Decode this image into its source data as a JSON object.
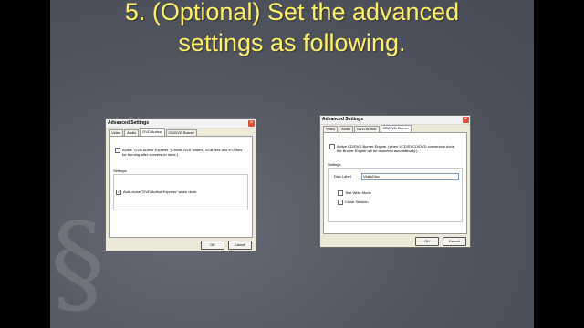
{
  "slide": {
    "title_line1": "5. (Optional) Set the advanced",
    "title_line2": "settings as following."
  },
  "dialog_left": {
    "title": "Advanced Settings",
    "tabs": [
      "Video",
      "Audio",
      "DVD Author",
      "CD/DVD Burner"
    ],
    "active_tab": "DVD Author",
    "activate_text": "Active \"DVD Author Express\" (Create DVD folders, VOB files and IFO files for burning after conversion done.)",
    "settings_label": "Settings",
    "autoclose_text": "Auto-close \"DVD Author Express\" when done.",
    "ok_label": "OK",
    "cancel_label": "Cancel"
  },
  "dialog_right": {
    "title": "Advanced Settings",
    "tabs": [
      "Video",
      "Audio",
      "DVD Author",
      "CD/DVD Burner"
    ],
    "active_tab": "CD/DVD Burner",
    "activate_text": "Active CD/DVD Burner Engine. (when VCD/SVCD/DVD conversion done, the Burner Engine will be launched automatically.)",
    "settings_label": "Settings",
    "disc_label_label": "Disc Label",
    "disc_label_value": "VideoDisc",
    "test_write_label": "Test Write Mode",
    "close_session_label": "Close Session",
    "ok_label": "OK",
    "cancel_label": "Cancel"
  },
  "colors": {
    "title_yellow": "#fff06a",
    "close_red": "#d9503a",
    "dialog_bg": "#ece9d8"
  }
}
